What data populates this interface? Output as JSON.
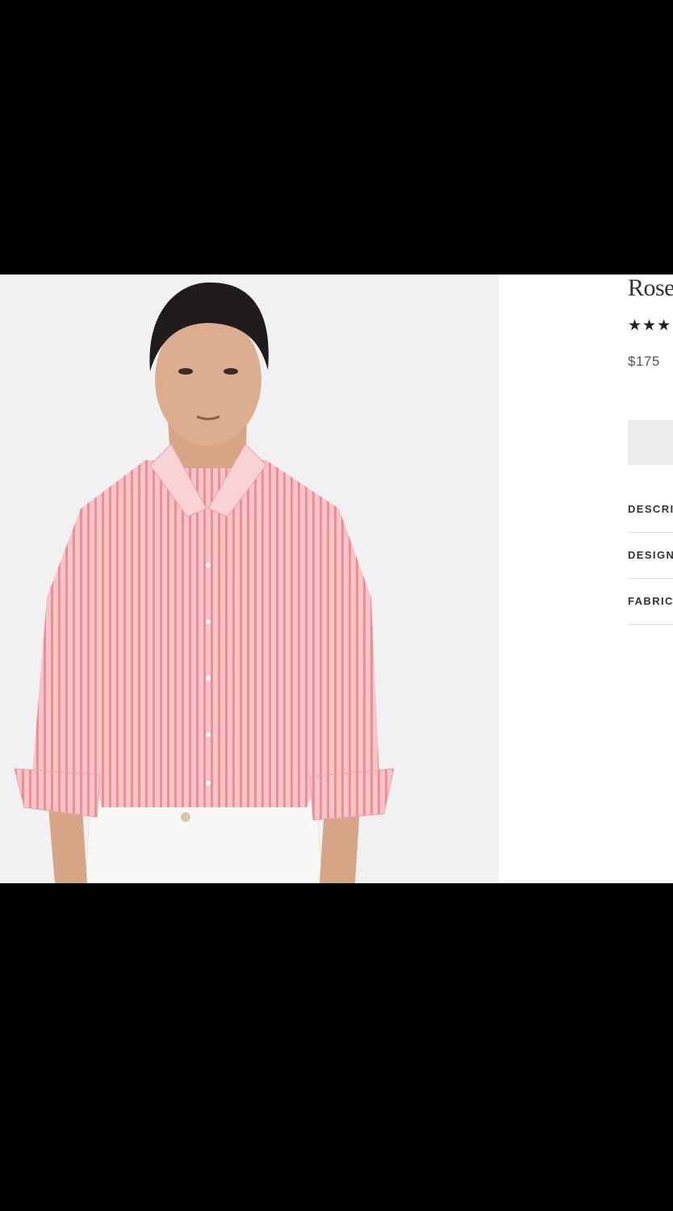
{
  "product": {
    "title": "Rose",
    "rating_stars": "★★★",
    "price": "$175",
    "image_icon": "product-photo",
    "image_background": "#f1f1f3",
    "shirt_color": "#f2a9ad"
  },
  "accordion": {
    "items": [
      {
        "label": "DESCRI"
      },
      {
        "label": "DESIGN"
      },
      {
        "label": "FABRIC"
      }
    ]
  }
}
